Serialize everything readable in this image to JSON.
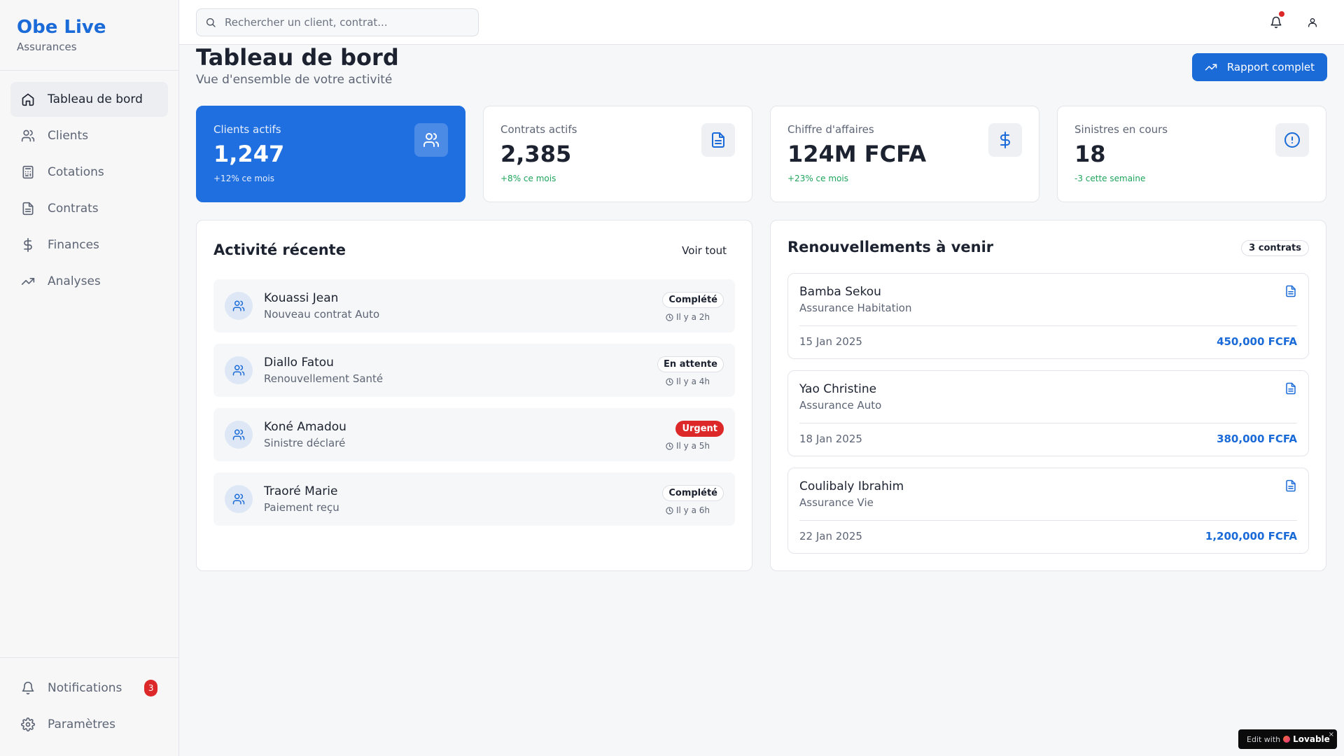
{
  "brand": {
    "title": "Obe Live",
    "subtitle": "Assurances"
  },
  "sidebar": {
    "items": [
      {
        "label": "Tableau de bord",
        "icon": "home-icon",
        "active": true
      },
      {
        "label": "Clients",
        "icon": "users-icon"
      },
      {
        "label": "Cotations",
        "icon": "calculator-icon"
      },
      {
        "label": "Contrats",
        "icon": "file-text-icon"
      },
      {
        "label": "Finances",
        "icon": "dollar-icon"
      },
      {
        "label": "Analyses",
        "icon": "trending-up-icon"
      }
    ],
    "bottom": [
      {
        "label": "Notifications",
        "icon": "bell-icon",
        "badge": "3"
      },
      {
        "label": "Paramètres",
        "icon": "gear-icon"
      }
    ]
  },
  "topbar": {
    "search_placeholder": "Rechercher un client, contrat..."
  },
  "page": {
    "title": "Tableau de bord",
    "subtitle": "Vue d'ensemble de votre activité",
    "report_button": "Rapport complet"
  },
  "stats": [
    {
      "label": "Clients actifs",
      "value": "1,247",
      "change": "+12% ce mois",
      "icon": "users-icon"
    },
    {
      "label": "Contrats actifs",
      "value": "2,385",
      "change": "+8% ce mois",
      "icon": "file-text-icon"
    },
    {
      "label": "Chiffre d'affaires",
      "value": "124M FCFA",
      "change": "+23% ce mois",
      "icon": "dollar-icon"
    },
    {
      "label": "Sinistres en cours",
      "value": "18",
      "change": "-3 cette semaine",
      "icon": "alert-circle-icon"
    }
  ],
  "activity": {
    "title": "Activité récente",
    "see_all": "Voir tout",
    "items": [
      {
        "name": "Kouassi Jean",
        "desc": "Nouveau contrat Auto",
        "status": "Complété",
        "time": "Il y a 2h"
      },
      {
        "name": "Diallo Fatou",
        "desc": "Renouvellement Santé",
        "status": "En attente",
        "time": "Il y a 4h"
      },
      {
        "name": "Koné Amadou",
        "desc": "Sinistre déclaré",
        "status": "Urgent",
        "time": "Il y a 5h"
      },
      {
        "name": "Traoré Marie",
        "desc": "Paiement reçu",
        "status": "Complété",
        "time": "Il y a 6h"
      }
    ]
  },
  "renewals": {
    "title": "Renouvellements à venir",
    "count": "3 contrats",
    "items": [
      {
        "name": "Bamba Sekou",
        "type": "Assurance Habitation",
        "date": "15 Jan 2025",
        "amount": "450,000 FCFA"
      },
      {
        "name": "Yao Christine",
        "type": "Assurance Auto",
        "date": "18 Jan 2025",
        "amount": "380,000 FCFA"
      },
      {
        "name": "Coulibaly Ibrahim",
        "type": "Assurance Vie",
        "date": "22 Jan 2025",
        "amount": "1,200,000 FCFA"
      }
    ]
  },
  "lovable": {
    "prefix": "Edit with",
    "brand": "Lovable",
    "close": "×"
  },
  "colors": {
    "accent": "#1a6ad8",
    "success": "#1ea45b",
    "danger": "#dc2828"
  }
}
